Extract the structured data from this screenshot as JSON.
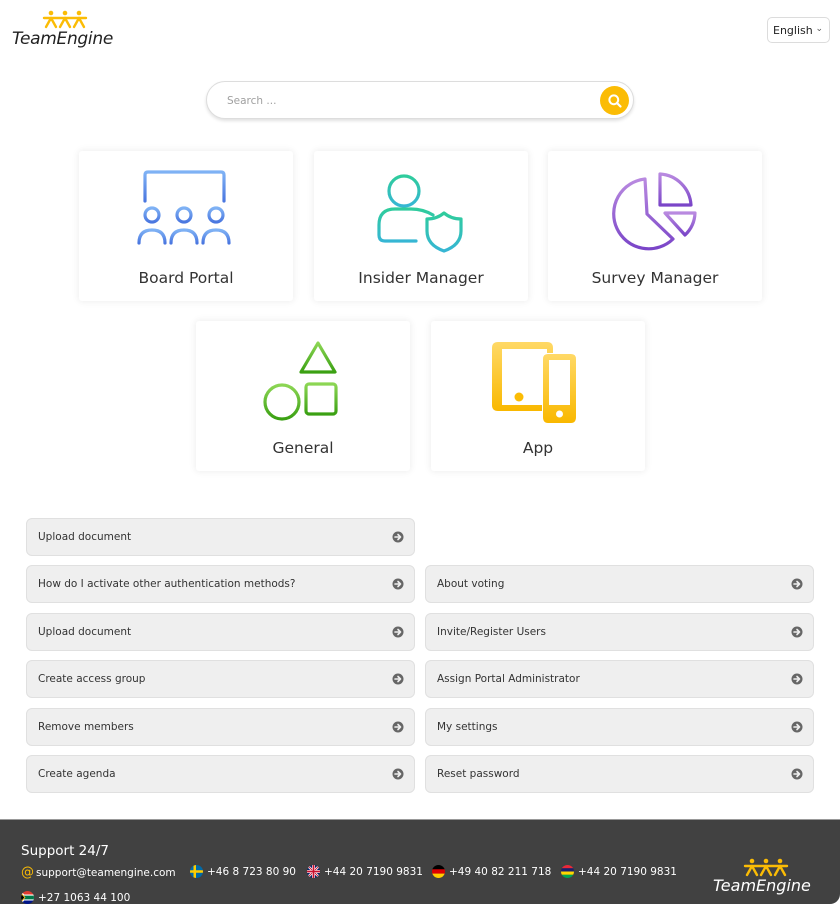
{
  "brand": {
    "name": "TeamEngine",
    "accent_color": "#fbbc05"
  },
  "header": {
    "language_select": {
      "selected": "English"
    }
  },
  "search": {
    "placeholder": "Search ...",
    "value": ""
  },
  "modules": [
    {
      "label": "Board Portal",
      "icon": "board-members-icon",
      "color": "#5b8def"
    },
    {
      "label": "Insider Manager",
      "icon": "user-shield-icon",
      "color": "#2ec4b6"
    },
    {
      "label": "Survey Manager",
      "icon": "pie-chart-icon",
      "color": "#8e5bd0"
    },
    {
      "label": "General",
      "icon": "shapes-icon",
      "color": "#4cae1c"
    },
    {
      "label": "App",
      "icon": "devices-icon",
      "color": "#fbbc05"
    }
  ],
  "faq": {
    "left": [
      "Upload document",
      "How do I activate other authentication methods?",
      "Upload document",
      "Create access group",
      "Remove members",
      "Create agenda"
    ],
    "right": [
      "About voting",
      "Invite/Register Users",
      "Assign Portal Administrator",
      "My settings",
      "Reset password"
    ]
  },
  "footer": {
    "title": "Support 24/7",
    "email": "support@teamengine.com",
    "phones": [
      {
        "country": "Sweden",
        "number": "+46 8 723 80 90"
      },
      {
        "country": "United Kingdom",
        "number": "+44 20 7190 9831"
      },
      {
        "country": "Germany",
        "number": "+49 40 82 211 718"
      },
      {
        "country": "Mauritius",
        "number": "+44 20 7190 9831"
      },
      {
        "country": "South Africa",
        "number": "+27 1063 44 100"
      }
    ]
  }
}
